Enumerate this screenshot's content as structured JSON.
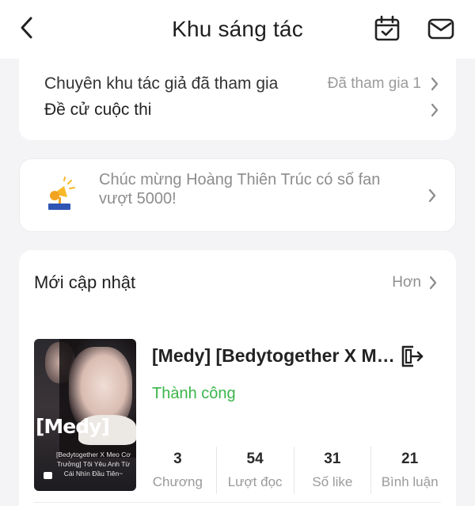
{
  "header": {
    "title": "Khu sáng tác",
    "back_icon": "chevron-left-icon",
    "calendar_icon": "calendar-check-icon",
    "mail_icon": "mail-icon"
  },
  "menu": {
    "partial_row": {
      "label": "Chuyên khu tác giả đã tham gia",
      "value": "Đã tham gia 1"
    },
    "contest_row": {
      "label": "Đề cử cuộc thi"
    }
  },
  "notice": {
    "text": "Chúc mừng Hoàng Thiên Trúc có số fan vượt 5000!",
    "icon": "trophy-megaphone-icon"
  },
  "updates": {
    "title": "Mới cập nhật",
    "more_label": "Hơn",
    "book": {
      "title": "[Medy] [Bedytogether X Me...",
      "status": "Thành công",
      "cover_brand": "[Medy]",
      "cover_subtitle": "[Bedytogether X Meo Cơ Trưởng] Tôi Yêu Anh Từ Cái Nhìn Đầu Tiên~",
      "stats": [
        {
          "value": "3",
          "label": "Chương"
        },
        {
          "value": "54",
          "label": "Lượt đọc"
        },
        {
          "value": "31",
          "label": "Số like"
        },
        {
          "value": "21",
          "label": "Bình luận"
        }
      ]
    }
  },
  "colors": {
    "background": "#f4f4f6",
    "card": "#ffffff",
    "status_green": "#3bb54a",
    "muted_text": "#9a9a9a"
  }
}
